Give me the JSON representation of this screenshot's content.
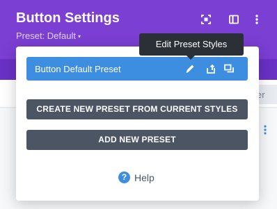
{
  "header": {
    "title": "Button Settings",
    "preset_label": "Preset: Default",
    "preset_caret": "▾",
    "icons": [
      "expand-icon",
      "split-view-icon",
      "more-vertical-icon"
    ]
  },
  "background": {
    "partial_button_text": "er",
    "right_icon": "more-vertical-icon"
  },
  "popup": {
    "preset_row": {
      "label": "Button Default Preset",
      "icons": [
        "edit-icon",
        "export-icon",
        "copy-icon"
      ]
    },
    "create_button": "CREATE NEW PRESET FROM CURRENT STYLES",
    "add_button": "ADD NEW PRESET",
    "help_glyph": "?",
    "help_label": "Help"
  },
  "tooltip": {
    "text": "Edit Preset Styles"
  },
  "colors": {
    "header_purple": "#7b3fd4",
    "header_purple_dark": "#6a31c6",
    "accent_blue": "#3d8de0",
    "button_gray": "#4b5563",
    "tooltip_bg": "#2b2f36"
  }
}
